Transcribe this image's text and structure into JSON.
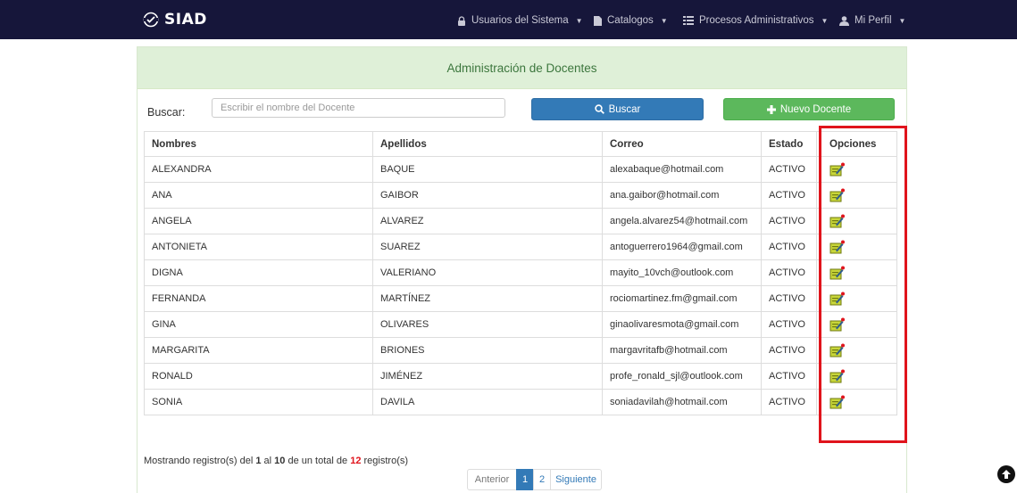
{
  "brand": {
    "name": "SIAD"
  },
  "nav": {
    "items": [
      {
        "label": "Usuarios del Sistema",
        "icon": "lock-icon"
      },
      {
        "label": "Catalogos",
        "icon": "file-icon"
      },
      {
        "label": "Procesos Administrativos",
        "icon": "list-icon"
      },
      {
        "label": "Mi Perfil",
        "icon": "user-icon"
      }
    ]
  },
  "panel": {
    "title": "Administración de Docentes"
  },
  "search": {
    "label": "Buscar:",
    "placeholder": "Escribir el nombre del Docente",
    "search_button": "Buscar",
    "new_button": "Nuevo Docente"
  },
  "table": {
    "columns": [
      "Nombres",
      "Apellidos",
      "Correo",
      "Estado",
      "Opciones"
    ],
    "rows": [
      {
        "nombres": "ALEXANDRA",
        "apellidos": "BAQUE",
        "correo": "alexabaque@hotmail.com",
        "estado": "ACTIVO"
      },
      {
        "nombres": "ANA",
        "apellidos": "GAIBOR",
        "correo": "ana.gaibor@hotmail.com",
        "estado": "ACTIVO"
      },
      {
        "nombres": "ANGELA",
        "apellidos": "ALVAREZ",
        "correo": "angela.alvarez54@hotmail.com",
        "estado": "ACTIVO"
      },
      {
        "nombres": "ANTONIETA",
        "apellidos": "SUAREZ",
        "correo": "antoguerrero1964@gmail.com",
        "estado": "ACTIVO"
      },
      {
        "nombres": "DIGNA",
        "apellidos": "VALERIANO",
        "correo": "mayito_10vch@outlook.com",
        "estado": "ACTIVO"
      },
      {
        "nombres": "FERNANDA",
        "apellidos": "MARTÍNEZ",
        "correo": "rociomartinez.fm@gmail.com",
        "estado": "ACTIVO"
      },
      {
        "nombres": "GINA",
        "apellidos": "OLIVARES",
        "correo": "ginaolivaresmota@gmail.com",
        "estado": "ACTIVO"
      },
      {
        "nombres": "MARGARITA",
        "apellidos": "BRIONES",
        "correo": "margavritafb@hotmail.com",
        "estado": "ACTIVO"
      },
      {
        "nombres": "RONALD",
        "apellidos": "JIMÉNEZ",
        "correo": "profe_ronald_sjl@outlook.com",
        "estado": "ACTIVO"
      },
      {
        "nombres": "SONIA",
        "apellidos": "DAVILA",
        "correo": "soniadavilah@hotmail.com",
        "estado": "ACTIVO"
      }
    ]
  },
  "footer": {
    "prefix": "Mostrando registro(s) del",
    "from": "1",
    "mid1": "al",
    "to": "10",
    "mid2": "de un total de",
    "total": "12",
    "suffix": "registro(s)"
  },
  "pagination": {
    "prev": "Anterior",
    "pages": [
      "1",
      "2"
    ],
    "next": "Siguiente",
    "current": "1"
  },
  "colors": {
    "navbar": "#16163a",
    "panel_heading": "#dff0d8",
    "primary": "#337ab7",
    "success": "#5cb85c",
    "highlight": "#e0141c"
  }
}
